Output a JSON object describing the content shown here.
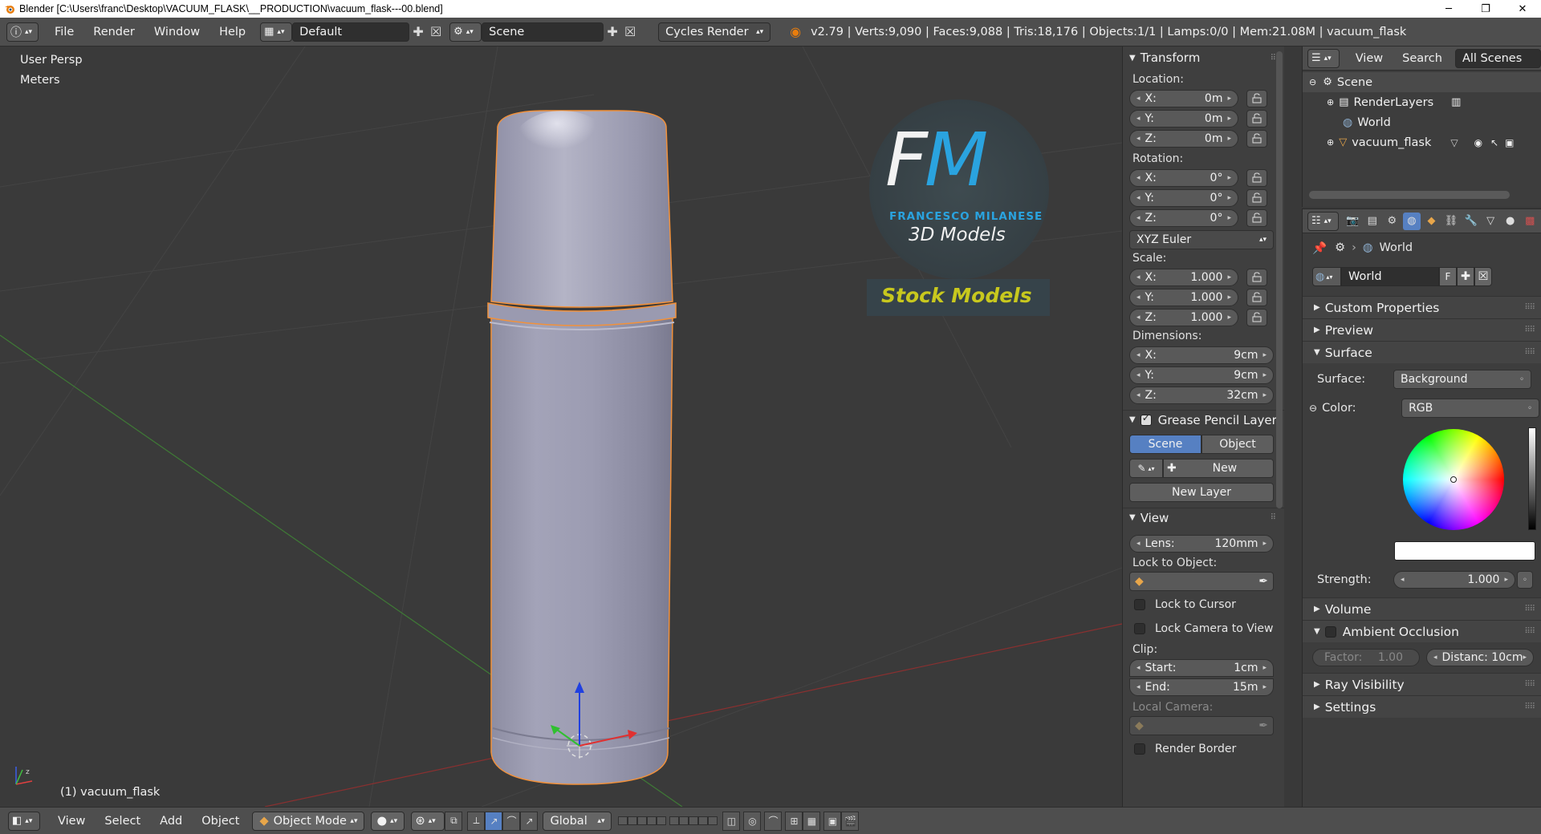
{
  "window": {
    "title": "Blender [C:\\Users\\franc\\Desktop\\VACUUM_FLASK\\__PRODUCTION\\vacuum_flask---00.blend]",
    "controls": [
      "─",
      "❐",
      "✕"
    ]
  },
  "info_header": {
    "menus": [
      "File",
      "Render",
      "Window",
      "Help"
    ],
    "screen_layout": "Default",
    "scene": "Scene",
    "render_engine": "Cycles Render",
    "stats": "v2.79 | Verts:9,090 | Faces:9,088 | Tris:18,176 | Objects:1/1 | Lamps:0/0 | Mem:21.08M | vacuum_flask"
  },
  "viewport": {
    "view_name": "User Persp",
    "units": "Meters",
    "object_label": "(1) vacuum_flask",
    "watermark": {
      "monogram": "FM",
      "author": "FRANCESCO MILANESE",
      "subtitle": "3D Models",
      "banner": "Stock Models"
    }
  },
  "npanel": {
    "transform": {
      "title": "Transform",
      "location_label": "Location:",
      "location": [
        {
          "axis": "X:",
          "value": "0m"
        },
        {
          "axis": "Y:",
          "value": "0m"
        },
        {
          "axis": "Z:",
          "value": "0m"
        }
      ],
      "rotation_label": "Rotation:",
      "rotation": [
        {
          "axis": "X:",
          "value": "0°"
        },
        {
          "axis": "Y:",
          "value": "0°"
        },
        {
          "axis": "Z:",
          "value": "0°"
        }
      ],
      "rotation_mode": "XYZ Euler",
      "scale_label": "Scale:",
      "scale": [
        {
          "axis": "X:",
          "value": "1.000"
        },
        {
          "axis": "Y:",
          "value": "1.000"
        },
        {
          "axis": "Z:",
          "value": "1.000"
        }
      ],
      "dimensions_label": "Dimensions:",
      "dimensions": [
        {
          "axis": "X:",
          "value": "9cm"
        },
        {
          "axis": "Y:",
          "value": "9cm"
        },
        {
          "axis": "Z:",
          "value": "32cm"
        }
      ]
    },
    "grease_pencil": {
      "title": "Grease Pencil Layer",
      "tab_scene": "Scene",
      "tab_object": "Object",
      "new_label": "New",
      "new_layer_label": "New Layer"
    },
    "view": {
      "title": "View",
      "lens_label": "Lens:",
      "lens_value": "120mm",
      "lock_to_object_label": "Lock to Object:",
      "lock_to_cursor": "Lock to Cursor",
      "lock_camera_to_view": "Lock Camera to View",
      "clip_label": "Clip:",
      "clip_start_label": "Start:",
      "clip_start_value": "1cm",
      "clip_end_label": "End:",
      "clip_end_value": "15m",
      "local_camera_label": "Local Camera:",
      "render_border": "Render Border"
    }
  },
  "outliner": {
    "menu_view": "View",
    "menu_search": "Search",
    "filter": "All Scenes",
    "items": [
      {
        "label": "Scene"
      },
      {
        "label": "RenderLayers"
      },
      {
        "label": "World"
      },
      {
        "label": "vacuum_flask"
      }
    ]
  },
  "properties": {
    "breadcrumb": "World",
    "world_name": "World",
    "fake_user": "F",
    "sections": {
      "custom_properties": "Custom Properties",
      "preview": "Preview",
      "surface": "Surface",
      "volume": "Volume",
      "ambient_occlusion": "Ambient Occlusion",
      "ray_visibility": "Ray Visibility",
      "settings": "Settings"
    },
    "surface_label": "Surface:",
    "surface_value": "Background",
    "color_label": "Color:",
    "color_value": "RGB",
    "strength_label": "Strength:",
    "strength_value": "1.000",
    "ao_factor_label": "Factor:",
    "ao_factor_value": "1.00",
    "ao_distance": "Distanc: 10cm"
  },
  "bottom_bar": {
    "menus": [
      "View",
      "Select",
      "Add",
      "Object"
    ],
    "mode": "Object Mode",
    "orientation": "Global"
  },
  "colors": {
    "accent": "#5680c2",
    "selection_outline": "#f2913a",
    "watermark_banner_text": "#c8c81e",
    "watermark_blue": "#2aa3df"
  }
}
